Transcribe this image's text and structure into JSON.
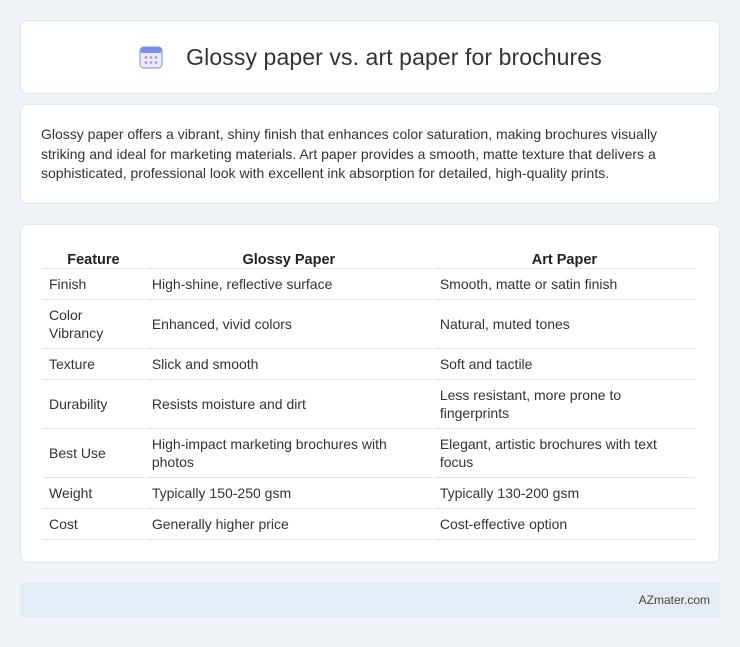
{
  "header": {
    "title": "Glossy paper vs. art paper for brochures",
    "icon": "calendar-icon"
  },
  "summary": {
    "text": "Glossy paper offers a vibrant, shiny finish that enhances color saturation, making brochures visually striking and ideal for marketing materials. Art paper provides a smooth, matte texture that delivers a sophisticated, professional look with excellent ink absorption for detailed, high-quality prints."
  },
  "table": {
    "headers": [
      "Feature",
      "Glossy Paper",
      "Art Paper"
    ],
    "rows": [
      [
        "Finish",
        "High-shine, reflective surface",
        "Smooth, matte or satin finish"
      ],
      [
        "Color Vibrancy",
        "Enhanced, vivid colors",
        "Natural, muted tones"
      ],
      [
        "Texture",
        "Slick and smooth",
        "Soft and tactile"
      ],
      [
        "Durability",
        "Resists moisture and dirt",
        "Less resistant, more prone to fingerprints"
      ],
      [
        "Best Use",
        "High-impact marketing brochures with photos",
        "Elegant, artistic brochures with text focus"
      ],
      [
        "Weight",
        "Typically 150-250 gsm",
        "Typically 130-200 gsm"
      ],
      [
        "Cost",
        "Generally higher price",
        "Cost-effective option"
      ]
    ]
  },
  "footer": {
    "brand": "AZmater.com"
  },
  "colors": {
    "background": "#f0f3f8",
    "card": "#ffffff",
    "footer": "#e6ecf5",
    "icon_accent": "#7b8fe8"
  }
}
